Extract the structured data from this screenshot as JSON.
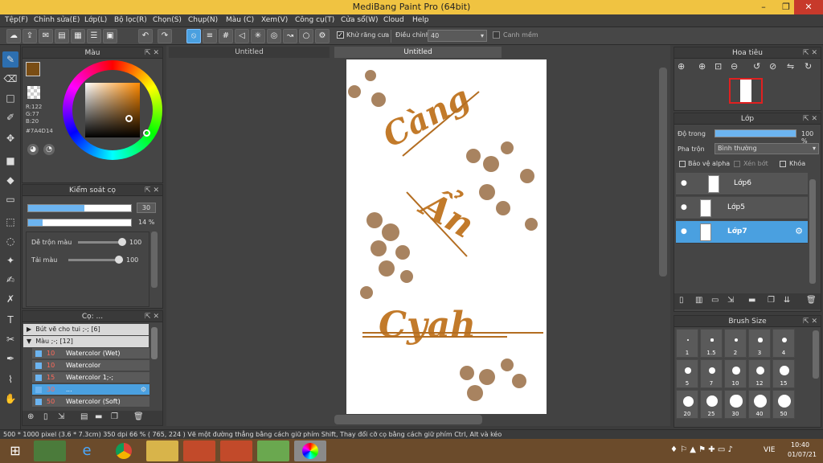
{
  "window": {
    "title": "MediBang Paint Pro (64bit)",
    "minimize": "–",
    "restore": "❐",
    "close": "✕"
  },
  "menu": [
    "Tệp(F)",
    "Chỉnh sửa(E)",
    "Lớp(L)",
    "Bộ lọc(R)",
    "Chọn(S)",
    "Chụp(N)",
    "Màu (C)",
    "Xem(V)",
    "Công cụ(T)",
    "Cửa sổ(W)",
    "Cloud",
    "Help"
  ],
  "toolbar": {
    "antialias_label": "Khử răng cưa",
    "adjust_label": "Điều chỉnh",
    "adjust_value": "40",
    "snap_label": "Canh mềm"
  },
  "color_panel": {
    "title": "Màu",
    "r": "R:122",
    "g": "G:77",
    "b": "B:20",
    "hex": "#7A4D14",
    "main_color": "#7A4D14"
  },
  "brush_control": {
    "title": "Kiểm soát cọ",
    "size_value": "30",
    "opacity_value": "14 %",
    "size_fill": 0.55,
    "opacity_fill": 0.14,
    "blend_label": "Dễ trộn màu",
    "blend_value": "100",
    "paint_label": "Tải màu",
    "paint_value": "100"
  },
  "brush_panel": {
    "title": "Cọ: ...",
    "groups": [
      {
        "name": "Bút vẽ cho tui ;-; [6]",
        "open": false
      },
      {
        "name": "Màu ;-; [12]",
        "open": true
      }
    ],
    "items": [
      {
        "size": "10",
        "name": "Watercolor (Wet)",
        "selected": false
      },
      {
        "size": "10",
        "name": "Watercolor",
        "selected": false
      },
      {
        "size": "15",
        "name": "Watercolor 1;-;",
        "selected": false
      },
      {
        "size": "30",
        "name": "...",
        "selected": true
      },
      {
        "size": "50",
        "name": "Watercolor (Soft)",
        "selected": false
      }
    ]
  },
  "tabs": {
    "left": "Untitled",
    "active": "Untitled"
  },
  "canvas_text": {
    "word1": "Càng",
    "word2": "Ẩn",
    "word3": "Cyah"
  },
  "navigator": {
    "title": "Hoa tiêu"
  },
  "layer_panel": {
    "title": "Lớp",
    "opacity_label": "Độ trong",
    "opacity_value": "100 %",
    "blend_label": "Pha trộn",
    "blend_value": "Bình thường",
    "protect_alpha": "Bảo vệ alpha",
    "clipping": "Xén bớt",
    "lock": "Khóa",
    "layers": [
      {
        "name": "Lớp6",
        "selected": false
      },
      {
        "name": "Lớp5",
        "selected": false
      },
      {
        "name": "Lớp7",
        "selected": true
      }
    ]
  },
  "brush_size": {
    "title": "Brush Size",
    "sizes": [
      "1",
      "1.5",
      "2",
      "3",
      "4",
      "5",
      "7",
      "10",
      "12",
      "15",
      "20",
      "25",
      "30",
      "40",
      "50"
    ]
  },
  "status": "500 * 1000 pixel   (3.6 * 7.3cm)   350 dpi   66 %   ( 765, 224 )   Vẽ một đường thẳng bằng cách giữ phím Shift, Thay đổi cỡ cọ bằng cách giữ phím Ctrl, Alt và kéo",
  "taskbar": {
    "lang": "VIE",
    "time": "10:40",
    "date": "01/07/21"
  }
}
